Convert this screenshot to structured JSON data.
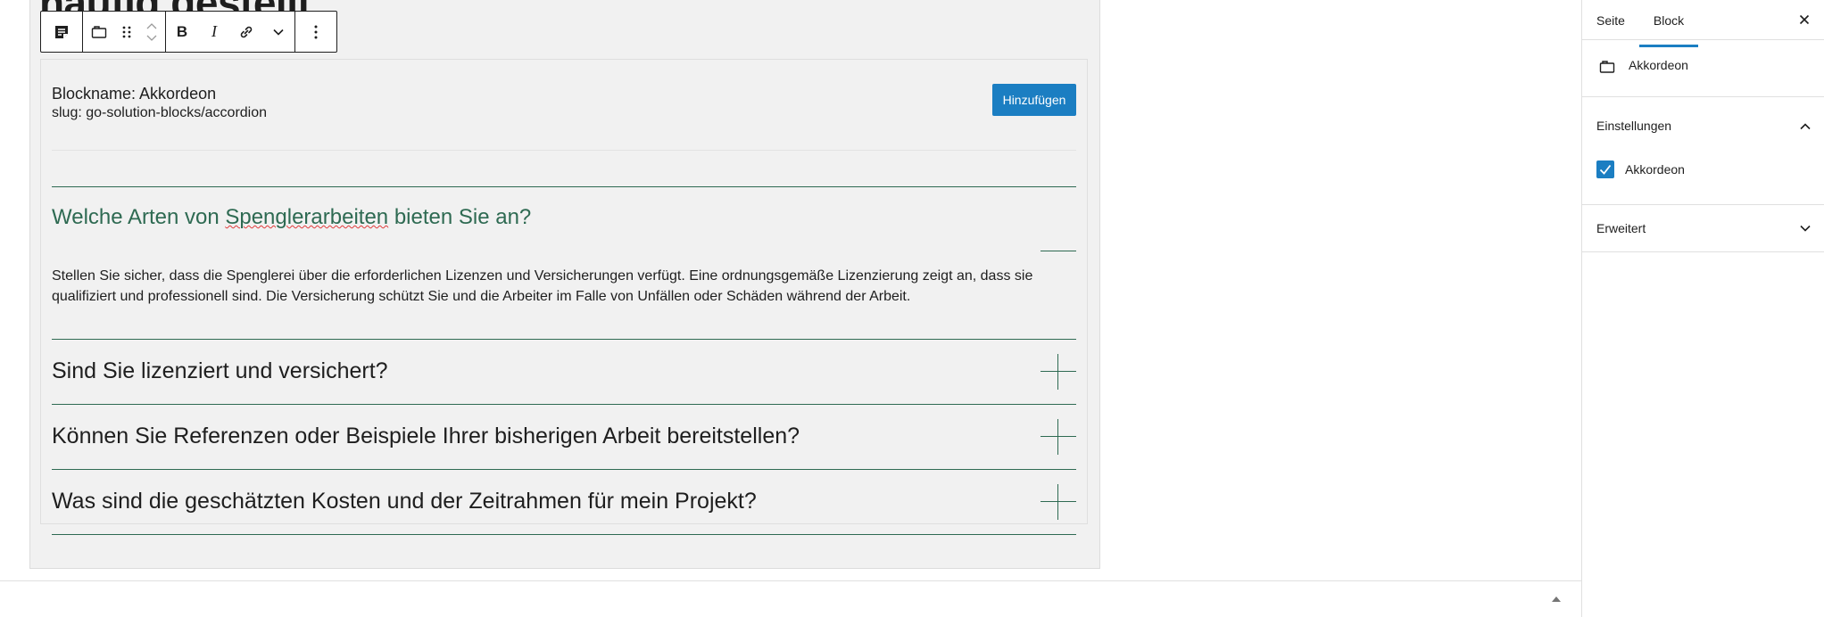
{
  "page": {
    "heading": "häufig gestellt"
  },
  "toolbar": {
    "block_type_icon": "form-icon",
    "accordion_icon": "accordion-block-icon",
    "drag_icon": "drag-handle-icon",
    "move_up_icon": "chevron-up-icon",
    "move_down_icon": "chevron-down-icon",
    "bold_label": "B",
    "italic_label": "I",
    "link_icon": "link-icon",
    "more_rich_icon": "chevron-down-icon",
    "options_icon": "more-vertical-icon"
  },
  "block": {
    "name": "Blockname: Akkordeon",
    "slug": "slug: go-solution-blocks/accordion",
    "add_button": "Hinzufügen"
  },
  "accordion": {
    "open_item": {
      "question_before": "Welche Arten von ",
      "question_misspelled": "Spenglerarbeiten",
      "question_after": " bieten Sie an?",
      "answer": "Stellen Sie sicher, dass die Spenglerei über die erforderlichen Lizenzen und Versicherungen verfügt. Eine ordnungsgemäße Lizenzierung zeigt an, dass sie qualifiziert und professionell sind. Die Versicherung schützt Sie und die Arbeiter im Falle von Unfällen oder Schäden während der Arbeit."
    },
    "items": [
      {
        "question": "Sind Sie lizenziert und versichert?"
      },
      {
        "question": "Können Sie Referenzen oder Beispiele Ihrer bisherigen Arbeit bereitstellen?"
      },
      {
        "question": "Was sind die geschätzten Kosten und der Zeitrahmen für mein Projekt?"
      }
    ]
  },
  "sidebar": {
    "tabs": [
      {
        "label": "Seite"
      },
      {
        "label": "Block"
      }
    ],
    "active_tab": "Block",
    "block_card_title": "Akkordeon",
    "panels": {
      "einstellungen": {
        "title": "Einstellungen",
        "checkbox_label": "Akkordeon",
        "checkbox_checked": true
      },
      "erweitert": {
        "title": "Erweitert"
      }
    }
  },
  "colors": {
    "accent_blue": "#1b7ec2",
    "accordion_green": "#2e6a52"
  }
}
